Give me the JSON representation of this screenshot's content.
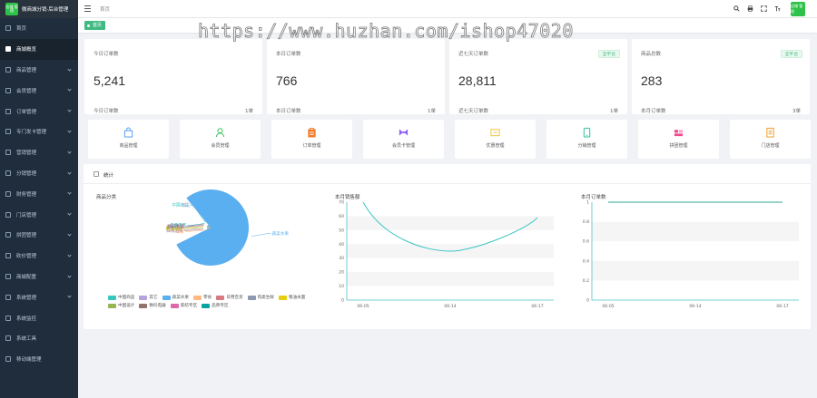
{
  "brand": {
    "logo_text": "店铺 管理",
    "title": "微商城分销·后台管理"
  },
  "sidebar": {
    "items": [
      {
        "label": "首页",
        "active": false
      },
      {
        "label": "商城概览",
        "active": true
      },
      {
        "label": "商品管理",
        "active": false
      },
      {
        "label": "会员管理",
        "active": false
      },
      {
        "label": "订单管理",
        "active": false
      },
      {
        "label": "专门发卡管理",
        "active": false
      },
      {
        "label": "营销管理",
        "active": false
      },
      {
        "label": "分销管理",
        "active": false
      },
      {
        "label": "财务管理",
        "active": false
      },
      {
        "label": "门店管理",
        "active": false
      },
      {
        "label": "拼团管理",
        "active": false
      },
      {
        "label": "砍价管理",
        "active": false
      },
      {
        "label": "商城配置",
        "active": false
      },
      {
        "label": "系统管理",
        "active": false
      },
      {
        "label": "系统监控",
        "active": false
      },
      {
        "label": "系统工具",
        "active": false
      },
      {
        "label": "移动端管理",
        "active": false
      }
    ]
  },
  "header": {
    "breadcrumb": "首页",
    "avatar_text": "店铺 管理"
  },
  "tags": {
    "active_tag": "首页"
  },
  "stats": [
    {
      "label": "今日订单数",
      "value": "5,241",
      "footer": "今日订单数",
      "unit": "1单",
      "badge": ""
    },
    {
      "label": "本日订单数",
      "value": "766",
      "footer": "本日订单数",
      "unit": "1单",
      "badge": ""
    },
    {
      "label": "近七天订单数",
      "value": "28,811",
      "footer": "近七天订单数",
      "unit": "1单",
      "badge": "全平台"
    },
    {
      "label": "商品总数",
      "value": "283",
      "footer": "本月订单数",
      "unit": "3单",
      "badge": "全平台"
    }
  ],
  "quick_links": [
    {
      "label": "商品管理",
      "icon": "bag-icon",
      "color": "#5aa0f0"
    },
    {
      "label": "会员管理",
      "icon": "user-icon",
      "color": "#3cc25c"
    },
    {
      "label": "订单管理",
      "icon": "clipboard-icon",
      "color": "#f07c2a"
    },
    {
      "label": "会员卡管理",
      "icon": "card-icon",
      "color": "#8b5cf6"
    },
    {
      "label": "优惠管理",
      "icon": "coupon-icon",
      "color": "#f5c542"
    },
    {
      "label": "分销管理",
      "icon": "phone-icon",
      "color": "#2ec2a0"
    },
    {
      "label": "拼团管理",
      "icon": "group-icon",
      "color": "#ee4c8c"
    },
    {
      "label": "门店管理",
      "icon": "store-icon",
      "color": "#f0a02a"
    }
  ],
  "panel": {
    "title": "统计",
    "pie_title": "商品分类",
    "line_title": "本月销售额",
    "bar_title": "本月订单数"
  },
  "colors": {
    "accent": "#42b983",
    "sidebar_bg": "#1f2d3d",
    "pie_main": "#5aaff0",
    "line": "#3cc6c6"
  },
  "chart_data": [
    {
      "type": "pie",
      "title": "商品分类",
      "slices": [
        {
          "name": "中国商品",
          "value": 2,
          "color": "#37c6c0"
        },
        {
          "name": "其它",
          "value": 1,
          "color": "#b6a2de"
        },
        {
          "name": "蔬菜水果",
          "value": 70,
          "color": "#5aaff0"
        },
        {
          "name": "零食",
          "value": 2,
          "color": "#ffb980"
        },
        {
          "name": "日用百货",
          "value": 2,
          "color": "#d87a80"
        },
        {
          "name": "肉类生鲜",
          "value": 2,
          "color": "#8d98b3"
        },
        {
          "name": "粮油米面",
          "value": 2,
          "color": "#e5cf0d"
        },
        {
          "name": "中国设计",
          "value": 2,
          "color": "#97b552"
        },
        {
          "name": "数码电器",
          "value": 2,
          "color": "#95706d"
        },
        {
          "name": "家纺专区",
          "value": 2,
          "color": "#dc69aa"
        },
        {
          "name": "品牌专区",
          "value": 2,
          "color": "#07a2a4"
        }
      ],
      "labels": [
        "中国商品",
        "其它",
        "蔬菜水果",
        "零食",
        "日用百货",
        "肉类生鲜",
        "粮油米面",
        "中国设计",
        "数码电器",
        "家纺专区",
        "品牌专区"
      ]
    },
    {
      "type": "line",
      "title": "本月销售额",
      "x": [
        "06-05",
        "06-14",
        "06-17"
      ],
      "series": [
        {
          "values": [
            70,
            35,
            59
          ]
        }
      ],
      "ylim": [
        0,
        70
      ],
      "yticks": [
        0,
        10,
        20,
        30,
        40,
        50,
        60,
        70
      ]
    },
    {
      "type": "line",
      "title": "本月订单数",
      "x": [
        "06-05",
        "06-14",
        "06-17"
      ],
      "series": [
        {
          "values": [
            1,
            1,
            1
          ]
        }
      ],
      "ylim": [
        0,
        1
      ],
      "yticks": [
        0,
        0.2,
        0.4,
        0.6,
        0.8,
        1
      ]
    }
  ],
  "watermark": "https://www.huzhan.com/ishop47020"
}
